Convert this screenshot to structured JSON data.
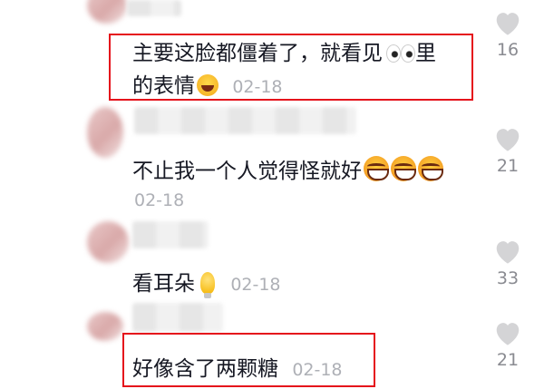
{
  "comments": [
    {
      "line1": "主要这脸都僵着了，就看见",
      "line1_emoji": "eyes-emoji",
      "line1_tail": "里",
      "line2": "的表情",
      "line2_emoji": "laugh-tears-emoji",
      "date": "02-18",
      "likes": "16",
      "highlighted": true
    },
    {
      "line1": "不止我一个人觉得怪就好",
      "line1_emoji": "grin-squint-emoji",
      "date": "02-18",
      "likes": "21",
      "highlighted": false
    },
    {
      "line1": "看耳朵",
      "line1_emoji": "lightbulb-emoji",
      "date": "02-18",
      "likes": "33",
      "highlighted": false
    },
    {
      "line1": "好像含了两颗糖",
      "date": "02-18",
      "likes": "21",
      "highlighted": true
    }
  ],
  "colors": {
    "text": "#161823",
    "date": "#aeb0b6",
    "likes": "#8a8b91",
    "heart": "#d4d4d6",
    "highlight_box": "#e5121b"
  },
  "icons": {
    "like": "heart-icon"
  }
}
